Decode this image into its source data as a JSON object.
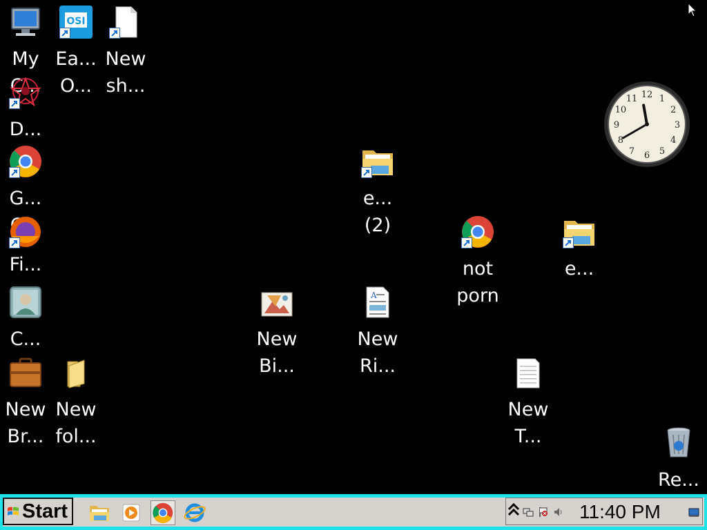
{
  "desktop_icons": [
    {
      "id": "my-computer",
      "label": "My\nC...",
      "icon": "computer-icon",
      "shortcut": false
    },
    {
      "id": "easeus",
      "label": "Ea...\nO...",
      "icon": "easeus-todo-icon",
      "shortcut": true
    },
    {
      "id": "new-shortcut",
      "label": "New\nsh...",
      "icon": "blank-file-icon",
      "shortcut": true
    },
    {
      "id": "d-app",
      "label": "D...",
      "icon": "red-star-app-icon",
      "shortcut": true
    },
    {
      "id": "google-chrome",
      "label": "G...\nC...",
      "icon": "chrome-icon",
      "shortcut": true
    },
    {
      "id": "firefox",
      "label": "Fi...",
      "icon": "firefox-icon",
      "shortcut": true
    },
    {
      "id": "contacts",
      "label": "C...",
      "icon": "contact-card-icon",
      "shortcut": false
    },
    {
      "id": "new-briefcase",
      "label": "New\nBr...",
      "icon": "briefcase-icon",
      "shortcut": false
    },
    {
      "id": "new-folder",
      "label": "New\nfol...",
      "icon": "folder-icon",
      "shortcut": false
    },
    {
      "id": "explorer-2",
      "label": "e...\n(2)",
      "icon": "explorer-folder-icon",
      "shortcut": true
    },
    {
      "id": "not-porn",
      "label": "not\nporn",
      "icon": "chrome-icon",
      "shortcut": true
    },
    {
      "id": "explorer",
      "label": "e...",
      "icon": "explorer-folder-icon",
      "shortcut": true
    },
    {
      "id": "new-bitmap",
      "label": "New\nBi...",
      "icon": "bitmap-image-icon",
      "shortcut": false
    },
    {
      "id": "new-rich-text",
      "label": "New\nRi...",
      "icon": "rich-text-document-icon",
      "shortcut": false
    },
    {
      "id": "new-text",
      "label": "New\nT...",
      "icon": "text-document-icon",
      "shortcut": false
    },
    {
      "id": "recycle-bin",
      "label": "Re...",
      "icon": "recycle-bin-icon",
      "shortcut": false
    }
  ],
  "clock_gadget": {
    "hours": [
      12,
      1,
      2,
      3,
      4,
      5,
      6,
      7,
      8,
      9,
      10,
      11
    ],
    "time": "11:40"
  },
  "taskbar": {
    "start_label": "Start",
    "quick_launch": [
      {
        "icon": "file-explorer-icon",
        "active": false
      },
      {
        "icon": "media-player-icon",
        "active": false
      },
      {
        "icon": "chrome-icon",
        "active": true
      },
      {
        "icon": "internet-explorer-icon",
        "active": false
      }
    ],
    "tray_icons": [
      "show-hidden-icons-chevron-icon",
      "network-icon",
      "action-center-flag-icon",
      "volume-icon"
    ],
    "time": "11:40 PM",
    "show_desktop_icon": "show-desktop-icon"
  },
  "colors": {
    "desktop_bg": "#000000",
    "taskbar_border": "#1fe2e8",
    "taskbar_bg": "#d6d3ce",
    "label_text": "#ffffff"
  }
}
